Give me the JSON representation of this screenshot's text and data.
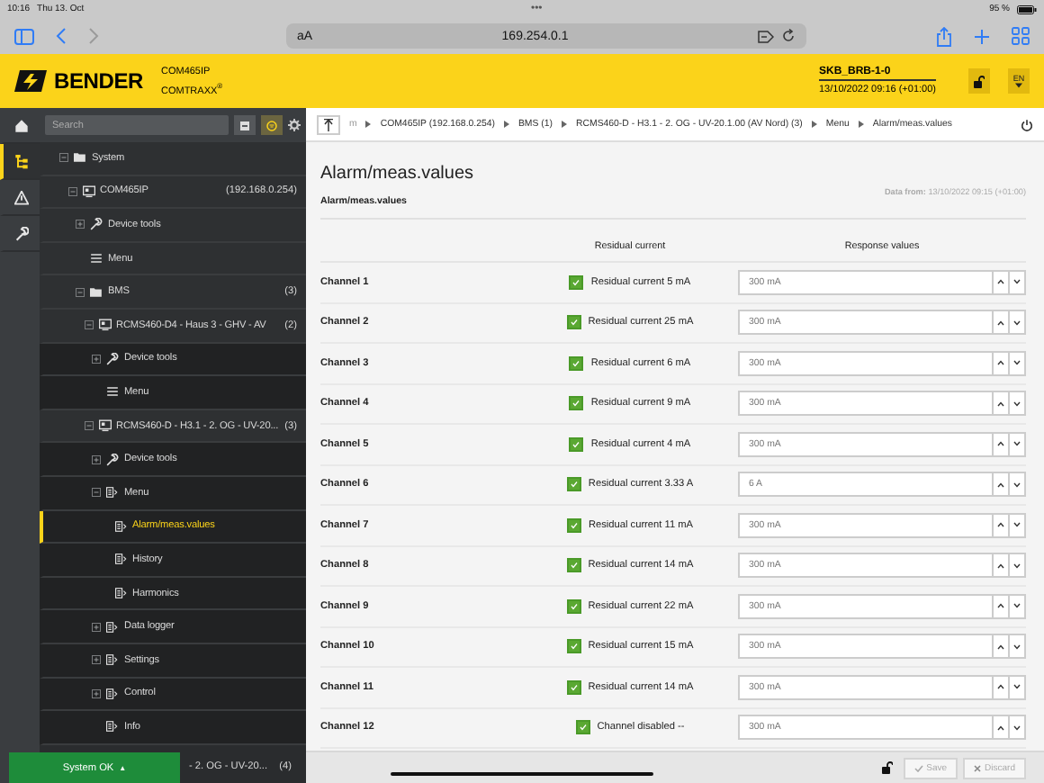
{
  "status_bar": {
    "time": "10:16",
    "date": "Thu 13. Oct",
    "dots": "•••",
    "battery": "95 %"
  },
  "browser": {
    "text_size": "aA",
    "url": "169.254.0.1",
    "forward_enabled": false
  },
  "header": {
    "brand": "BENDER",
    "product": "COM465IP",
    "product_line": "COMTRAXX$^{®}$",
    "device": "SKB_BRB-1-0",
    "datetime": "13/10/2022 09:16 (+01:00)",
    "language": "EN"
  },
  "nav_rail": [
    {
      "kind": "home",
      "selected": false
    },
    {
      "kind": "tree",
      "selected": true
    },
    {
      "kind": "warning",
      "selected": false
    },
    {
      "kind": "tools",
      "selected": false
    }
  ],
  "sidebar": {
    "search": {
      "placeholder": "Search"
    },
    "filter_on": true,
    "tree": [
      {
        "label": "System",
        "kind": "folder",
        "expanded": true,
        "selected": false,
        "children": [
          {
            "label": "COM465IP",
            "count": "(192.168.0.254)",
            "kind": "device",
            "expanded": true,
            "selected": false,
            "children": [
              {
                "label": "Device tools",
                "kind": "tools",
                "expanded": false,
                "selected": false
              },
              {
                "label": "Menu",
                "kind": "menu",
                "selected": false
              },
              {
                "label": "BMS",
                "count": "(3)",
                "kind": "folder",
                "expanded": true,
                "selected": false,
                "children": [
                  {
                    "label": "RCMS460-D4 - Haus 3 - GHV - AV",
                    "count": "(2)",
                    "kind": "device",
                    "expanded": true,
                    "selected": false,
                    "children": [
                      {
                        "label": "Device tools",
                        "kind": "tools",
                        "expanded": false,
                        "selected": false
                      },
                      {
                        "label": "Menu",
                        "kind": "menu",
                        "selected": false
                      }
                    ]
                  },
                  {
                    "label": "RCMS460-D - H3.1 - 2. OG - UV-20...",
                    "count": "(3)",
                    "kind": "device",
                    "expanded": true,
                    "selected": false,
                    "children": [
                      {
                        "label": "Device tools",
                        "kind": "tools",
                        "expanded": false,
                        "selected": false
                      },
                      {
                        "label": "Menu",
                        "kind": "page",
                        "expanded": true,
                        "selected": false,
                        "children": [
                          {
                            "label": "Alarm/meas.values",
                            "kind": "page",
                            "selected": true
                          },
                          {
                            "label": "History",
                            "kind": "page",
                            "selected": false
                          },
                          {
                            "label": "Harmonics",
                            "kind": "page",
                            "selected": false
                          }
                        ]
                      },
                      {
                        "label": "Data logger",
                        "kind": "page",
                        "expanded": false,
                        "selected": false
                      },
                      {
                        "label": "Settings",
                        "kind": "page",
                        "expanded": false,
                        "selected": false
                      },
                      {
                        "label": "Control",
                        "kind": "page",
                        "expanded": false,
                        "selected": false
                      },
                      {
                        "label": "Info",
                        "kind": "page",
                        "selected": false
                      }
                    ]
                  }
                ]
              }
            ]
          }
        ]
      }
    ],
    "partial_row": {
      "label": "- 2. OG - UV-20...",
      "count": "(4)"
    },
    "status_button": {
      "label": "System OK",
      "arrow": "▲"
    }
  },
  "breadcrumb": [
    "m",
    "COM465IP (192.168.0.254)",
    "BMS (1)",
    "RCMS460-D - H3.1 - 2. OG - UV-20.1.00 (AV Nord) (3)",
    "Menu",
    "Alarm/meas.values"
  ],
  "content": {
    "title": "Alarm/meas.values",
    "data_from": "**Data from:** 13/10/2022 09:15 (+01:00)",
    "section": "Alarm/meas.values",
    "columns": [
      "Residual current",
      "Response values"
    ],
    "rows": [
      {
        "channel": "Channel 1",
        "checked": true,
        "status": "Residual current 5 mA",
        "value": "300 mA"
      },
      {
        "channel": "Channel 2",
        "checked": true,
        "status": "Residual current 25 mA",
        "value": "300 mA"
      },
      {
        "channel": "Channel 3",
        "checked": true,
        "status": "Residual current 6 mA",
        "value": "300 mA"
      },
      {
        "channel": "Channel 4",
        "checked": true,
        "status": "Residual current 9 mA",
        "value": "300 mA"
      },
      {
        "channel": "Channel 5",
        "checked": true,
        "status": "Residual current 4 mA",
        "value": "300 mA"
      },
      {
        "channel": "Channel 6",
        "checked": true,
        "status": "Residual current 3.33 A",
        "value": "6 A"
      },
      {
        "channel": "Channel 7",
        "checked": true,
        "status": "Residual current 11 mA",
        "value": "300 mA"
      },
      {
        "channel": "Channel 8",
        "checked": true,
        "status": "Residual current 14 mA",
        "value": "300 mA"
      },
      {
        "channel": "Channel 9",
        "checked": true,
        "status": "Residual current 22 mA",
        "value": "300 mA"
      },
      {
        "channel": "Channel 10",
        "checked": true,
        "status": "Residual current 15 mA",
        "value": "300 mA"
      },
      {
        "channel": "Channel 11",
        "checked": true,
        "status": "Residual current 14 mA",
        "value": "300 mA"
      },
      {
        "channel": "Channel 12",
        "checked": true,
        "status": "Channel disabled --",
        "value": "300 mA"
      }
    ]
  },
  "footer": {
    "save": {
      "label": "Save",
      "disabled": true
    },
    "discard": {
      "label": "Discard",
      "disabled": true
    }
  }
}
